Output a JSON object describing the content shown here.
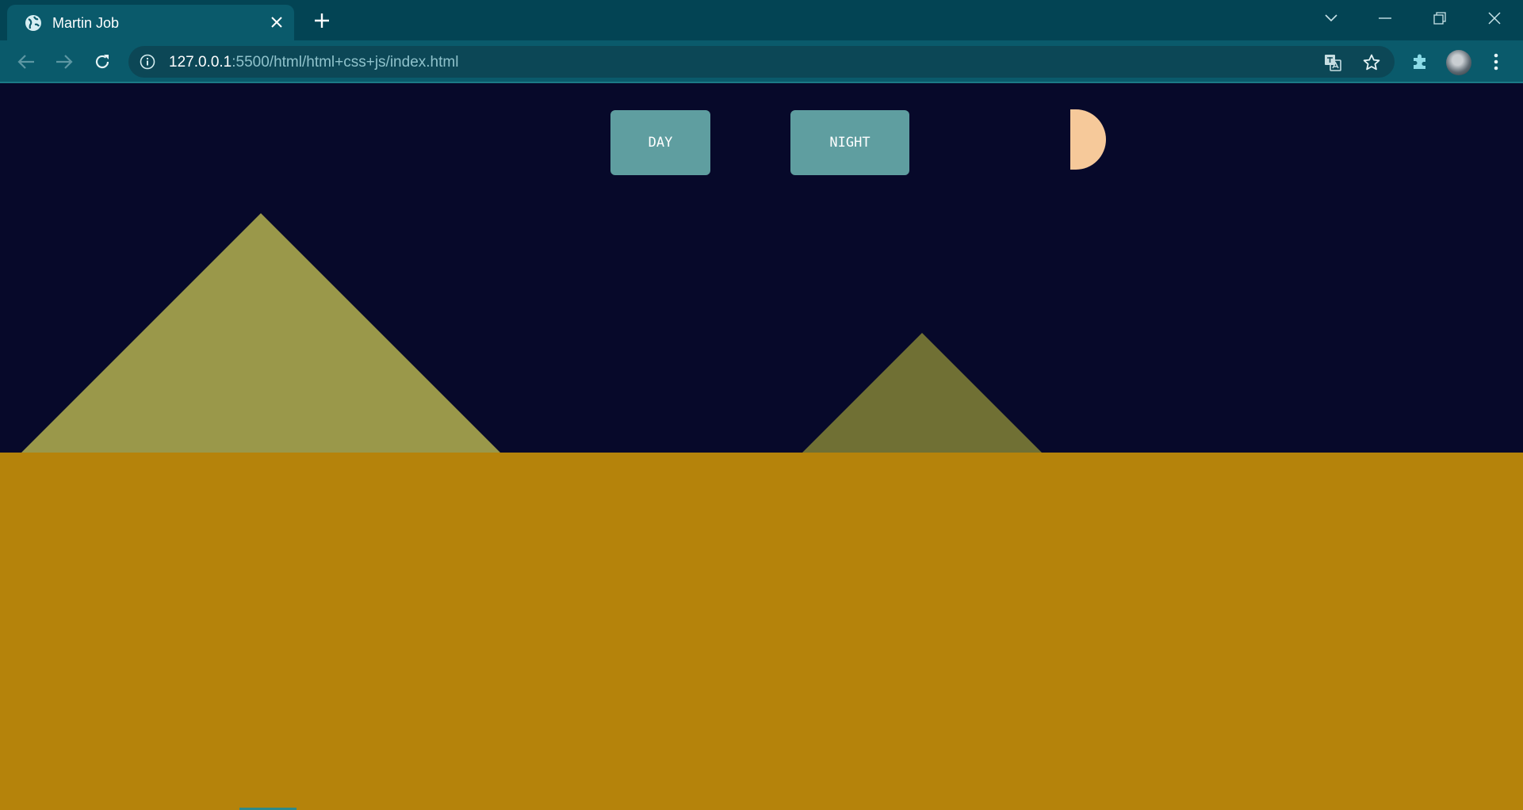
{
  "browser": {
    "tab": {
      "title": "Martin Job",
      "favicon": "globe-icon"
    },
    "new_tab_icon": "plus-icon",
    "window_controls": [
      "chevron-down-icon",
      "minimize-icon",
      "restore-icon",
      "close-icon"
    ],
    "address_bar": {
      "host": "127.0.0.1",
      "path": ":5500/html/html+css+js/index.html"
    },
    "toolbar_icons": [
      "back-icon",
      "forward-icon",
      "reload-icon",
      "info-icon",
      "translate-icon",
      "star-icon",
      "extensions-icon",
      "profile-avatar",
      "menu-icon"
    ]
  },
  "page": {
    "buttons": {
      "day": "DAY",
      "night": "NIGHT"
    },
    "colors": {
      "sky": "#07092a",
      "sand": "#b5830b",
      "moon": "#f6c99a",
      "pyramid_large": "#9a984a",
      "pyramid_small": "#707034",
      "button": "#5f9ea0"
    }
  }
}
